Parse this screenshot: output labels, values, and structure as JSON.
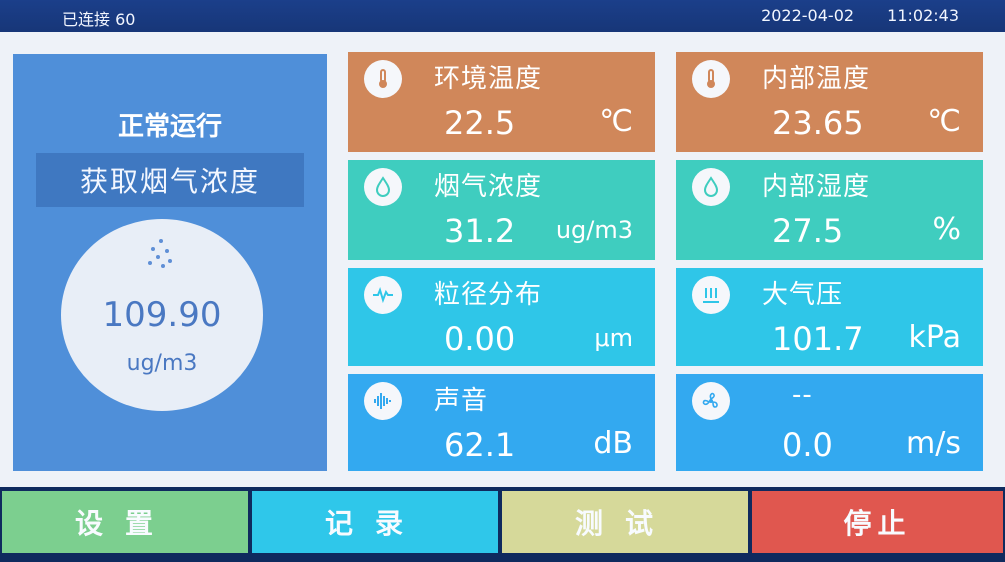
{
  "topbar": {
    "connection": "已连接 60",
    "date": "2022-04-02",
    "time": "11:02:43"
  },
  "status": {
    "title": "正常运行",
    "subtitle": "获取烟气浓度"
  },
  "gauge": {
    "value": "109.90",
    "unit": "ug/m3"
  },
  "cards": [
    {
      "title": "环境温度",
      "value": "22.5",
      "unit": "℃",
      "icon": "thermometer-icon",
      "color": "#d0875a"
    },
    {
      "title": "内部温度",
      "value": "23.65",
      "unit": "℃",
      "icon": "thermometer-icon",
      "color": "#d0875a"
    },
    {
      "title": "烟气浓度",
      "value": "31.2",
      "unit": "ug/m3",
      "icon": "droplet-icon",
      "color": "#3fcdbf"
    },
    {
      "title": "内部湿度",
      "value": "27.5",
      "unit": "%",
      "icon": "droplet-icon",
      "color": "#3fcdbf"
    },
    {
      "title": "粒径分布",
      "value": "0.00",
      "unit": "μm",
      "icon": "waveform-icon",
      "color": "#2fc6e8"
    },
    {
      "title": "大气压",
      "value": "101.7",
      "unit": "kPa",
      "icon": "pressure-icon",
      "color": "#2fc6e8"
    },
    {
      "title": "声音",
      "value": "62.1",
      "unit": "dB",
      "icon": "sound-icon",
      "color": "#33a9f0"
    },
    {
      "title": "--",
      "value": "0.0",
      "unit": "m/s",
      "icon": "fan-icon",
      "color": "#33a9f0"
    }
  ],
  "buttons": [
    {
      "label": "设置",
      "color": "#7ccf8f"
    },
    {
      "label": "记录",
      "color": "#2fc7ea"
    },
    {
      "label": "测试",
      "color": "#d6d99a"
    },
    {
      "label": "停止",
      "color": "#e0574f"
    }
  ]
}
